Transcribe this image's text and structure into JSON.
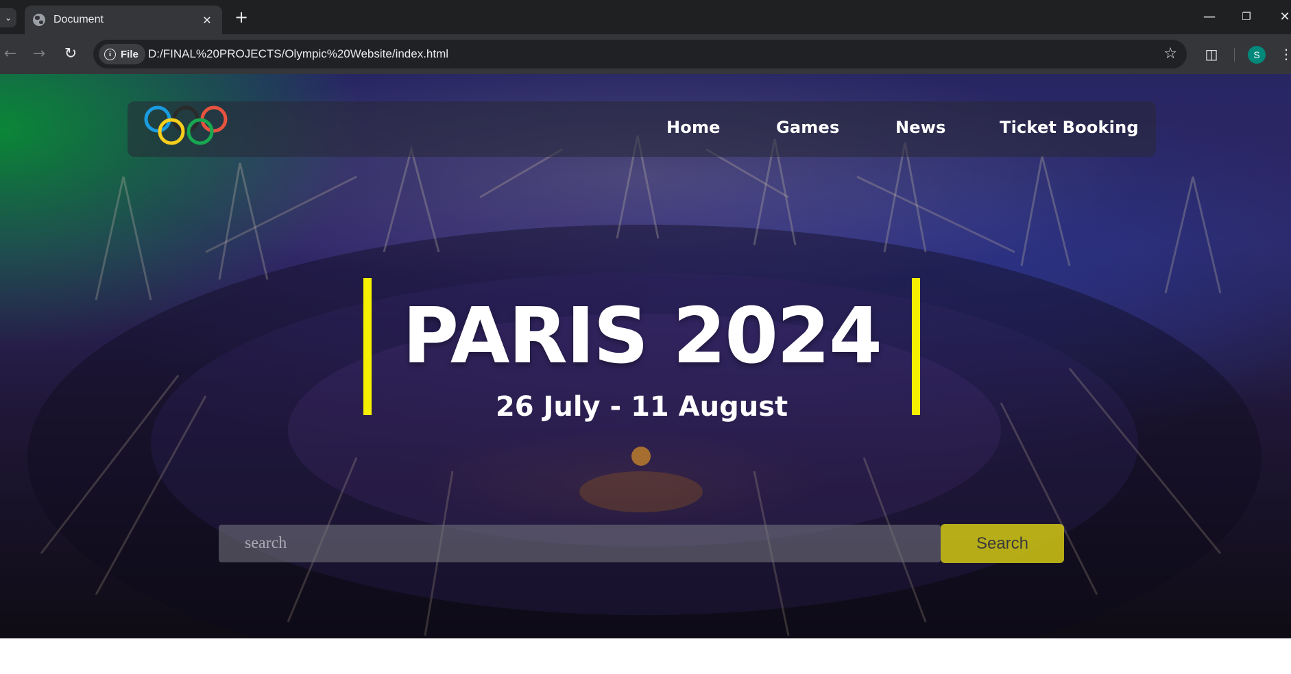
{
  "browser": {
    "tab_title": "Document",
    "new_tab": "+",
    "site_chip": "File",
    "url": "D:/FINAL%20PROJECTS/Olympic%20Website/index.html",
    "profile_initial": "S"
  },
  "nav": {
    "items": [
      "Home",
      "Games",
      "News",
      "Ticket Booking"
    ]
  },
  "hero": {
    "title": "PARIS 2024",
    "dates": "26 July - 11 August",
    "accent_color": "#f5ef00"
  },
  "search": {
    "placeholder": "search",
    "button_label": "Search"
  },
  "logo": {
    "ring_colors": [
      "#1a9de0",
      "#2a2a2a",
      "#e8533f",
      "#f6cf1c",
      "#18a850"
    ]
  }
}
